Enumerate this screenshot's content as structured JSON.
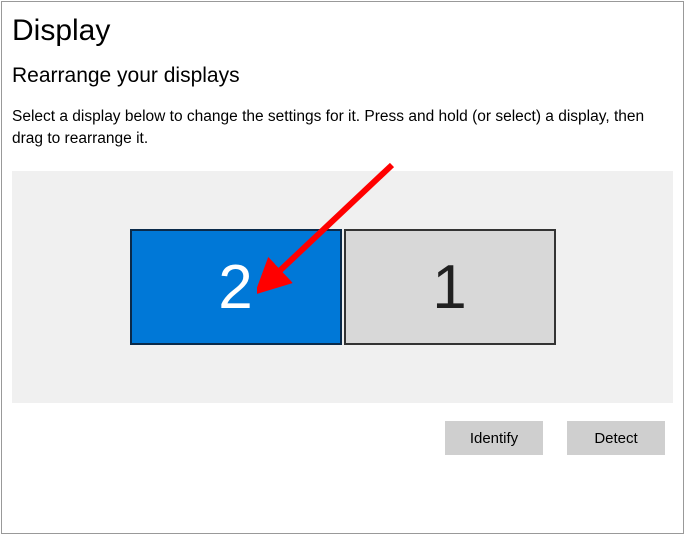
{
  "header": {
    "title": "Display",
    "subtitle": "Rearrange your displays",
    "description": "Select a display below to change the settings for it. Press and hold (or select) a display, then drag to rearrange it."
  },
  "monitors": {
    "left": {
      "label": "2",
      "selected": true
    },
    "right": {
      "label": "1",
      "selected": false
    }
  },
  "buttons": {
    "identify": "Identify",
    "detect": "Detect"
  },
  "annotation": {
    "arrow_color": "#ff0000"
  }
}
